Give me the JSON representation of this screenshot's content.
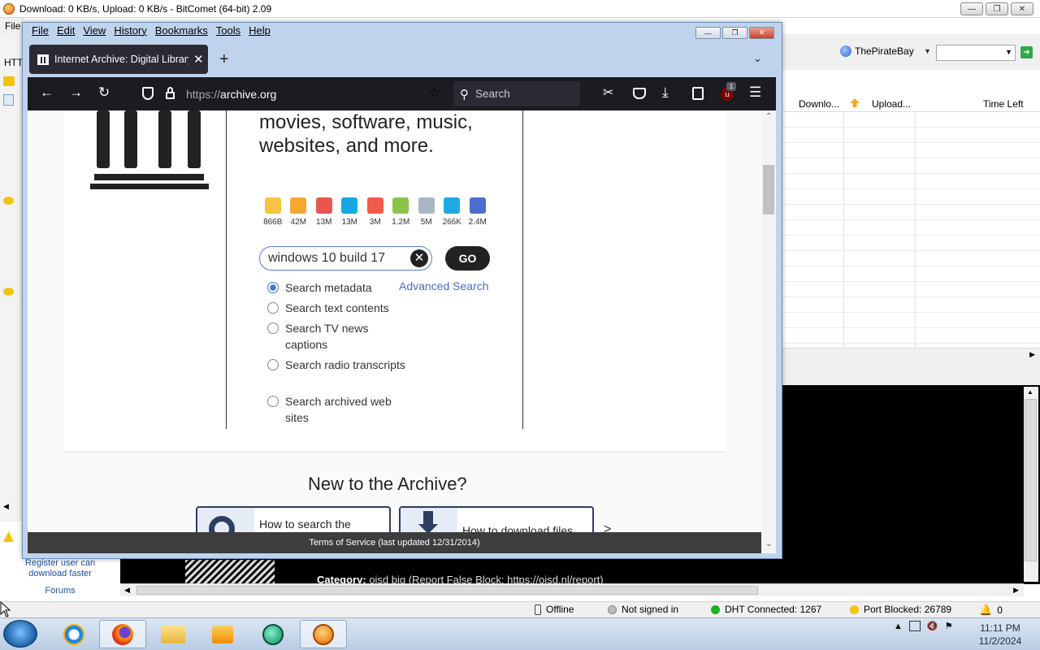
{
  "bitcomet": {
    "title": "Download: 0 KB/s, Upload: 0 KB/s - BitComet (64-bit) 2.09",
    "menu_first": "File",
    "left_label": "HTT",
    "source_name": "ThePirateBay",
    "list_columns": [
      "Downlo...",
      "Upload...",
      "Time Left"
    ],
    "log_category_label": "Category:",
    "log_category_text": "oisd big (Report False Block: https://oisd.nl/report)",
    "sidebar_links": [
      "Register user can download faster",
      "Forums"
    ],
    "status": {
      "connection": "Offline",
      "account": "Not signed in",
      "dht": "DHT Connected: 1267",
      "port": "Port Blocked: 26789",
      "alerts": "0"
    }
  },
  "taskbar": {
    "time": "11:11 PM",
    "date": "11/2/2024"
  },
  "firefox": {
    "menus": [
      "File",
      "Edit",
      "View",
      "History",
      "Bookmarks",
      "Tools",
      "Help"
    ],
    "tab_title": "Internet Archive: Digital Library",
    "url_prefix": "https://",
    "url_host": "archive.org",
    "search_placeholder": "Search",
    "extension_badge": "1"
  },
  "archive": {
    "tagline": "movies, software, music, websites, and more.",
    "media_counts": [
      {
        "icon": "web-icon",
        "count": "866B",
        "color": "#f6c342"
      },
      {
        "icon": "texts-icon",
        "count": "42M",
        "color": "#f4a830"
      },
      {
        "icon": "video-icon",
        "count": "13M",
        "color": "#e8574f"
      },
      {
        "icon": "audio-icon",
        "count": "13M",
        "color": "#16a8e0"
      },
      {
        "icon": "tv-icon",
        "count": "3M",
        "color": "#f15b4e"
      },
      {
        "icon": "software-icon",
        "count": "1.2M",
        "color": "#8bc34a"
      },
      {
        "icon": "images-icon",
        "count": "5M",
        "color": "#a9b6c6"
      },
      {
        "icon": "concerts-icon",
        "count": "266K",
        "color": "#1fa9e1"
      },
      {
        "icon": "collections-icon",
        "count": "2.4M",
        "color": "#4c6fcd"
      }
    ],
    "search_value": "windows 10 build 17",
    "go_label": "GO",
    "advanced_search": "Advanced Search",
    "search_options": [
      {
        "label": "Search metadata",
        "selected": true
      },
      {
        "label": "Search text contents",
        "selected": false
      },
      {
        "label": "Search TV news captions",
        "selected": false
      },
      {
        "label": "Search radio transcripts",
        "selected": false
      },
      {
        "label": "Search archived web sites",
        "selected": false
      }
    ],
    "new_title": "New to the Archive?",
    "howto": [
      "How to search the",
      "How to download files"
    ],
    "howto_more": ">",
    "terms": "Terms of Service (last updated 12/31/2014)"
  }
}
